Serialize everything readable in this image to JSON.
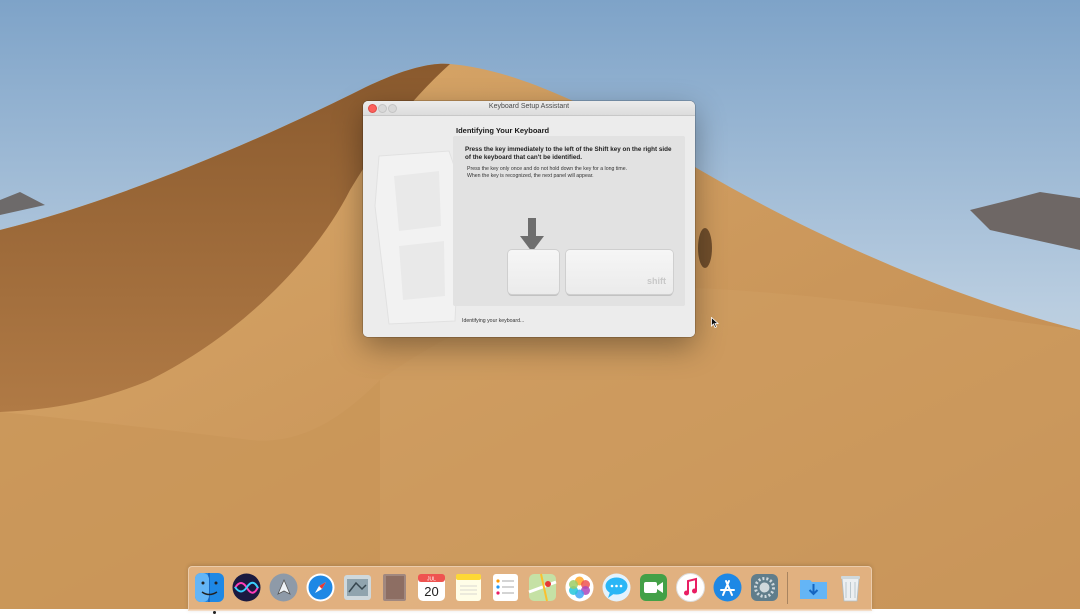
{
  "window": {
    "title": "Keyboard Setup Assistant",
    "heading": "Identifying Your Keyboard",
    "instruction": "Press the key immediately to the left of the Shift key on the right side of the keyboard that can't be identified.",
    "detail_line1": "Press the key only once and do not hold down the key for a long time.",
    "detail_line2": "When the key is recognized, the next panel will appear.",
    "shift_label": "shift",
    "status": "Identifying your keyboard...",
    "colors": {
      "close": "#fc605c",
      "panel": "#e2e2e2"
    }
  },
  "dock": {
    "items": [
      {
        "name": "finder-icon"
      },
      {
        "name": "siri-icon"
      },
      {
        "name": "launchpad-icon"
      },
      {
        "name": "safari-icon"
      },
      {
        "name": "mail-icon"
      },
      {
        "name": "contacts-icon"
      },
      {
        "name": "calendar-icon",
        "month": "JUL",
        "day": "20"
      },
      {
        "name": "notes-icon"
      },
      {
        "name": "reminders-icon"
      },
      {
        "name": "maps-icon"
      },
      {
        "name": "photos-icon"
      },
      {
        "name": "messages-icon"
      },
      {
        "name": "facetime-icon"
      },
      {
        "name": "itunes-icon"
      },
      {
        "name": "app-store-icon"
      },
      {
        "name": "system-preferences-icon"
      },
      {
        "name": "downloads-icon"
      },
      {
        "name": "trash-icon"
      }
    ]
  }
}
